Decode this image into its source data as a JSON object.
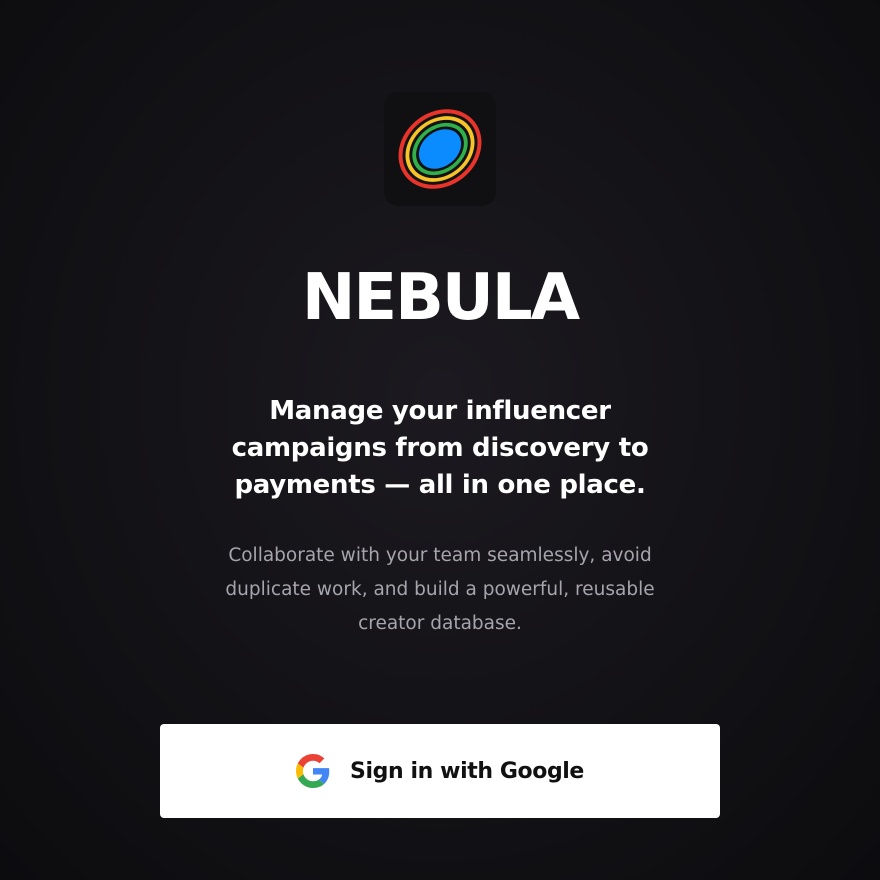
{
  "brand": {
    "name": "NEBULA",
    "logo_icon": "nebula-rings-icon",
    "logo_colors": [
      "#e8342a",
      "#f6c428",
      "#2fb04a",
      "#0a8cff"
    ]
  },
  "hero": {
    "headline": "Manage your influencer campaigns from discovery to payments — all in one place.",
    "subtext": "Collaborate with your team seamlessly, avoid duplicate work, and build a powerful, reusable creator database."
  },
  "auth": {
    "google_button_label": "Sign in with Google",
    "google_icon": "google-g-icon"
  }
}
